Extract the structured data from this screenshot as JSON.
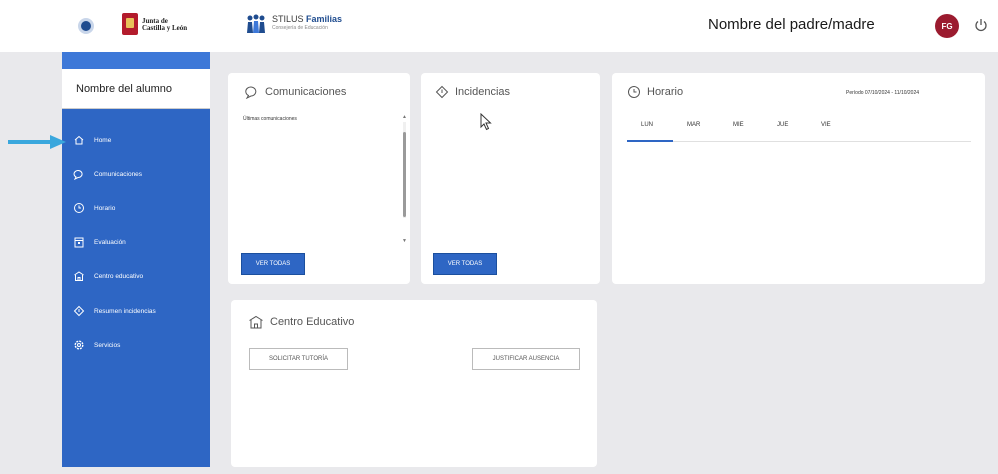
{
  "header": {
    "org_name_line1": "Junta de",
    "org_name_line2": "Castilla y León",
    "app_title_prefix": "STILUS ",
    "app_title_bold": "Familias",
    "app_subtitle": "Consejería de Educación",
    "parent_name": "Nombre del padre/madre",
    "avatar_initials": "FG"
  },
  "sidebar": {
    "student_name": "Nombre del alumno",
    "items": [
      {
        "label": "Home",
        "icon": "home-icon"
      },
      {
        "label": "Comunicaciones",
        "icon": "chat-icon"
      },
      {
        "label": "Horario",
        "icon": "clock-icon"
      },
      {
        "label": "Evaluación",
        "icon": "calendar-icon"
      },
      {
        "label": "Centro educativo",
        "icon": "school-icon"
      },
      {
        "label": "Resumen incidencias",
        "icon": "warning-diamond-icon"
      },
      {
        "label": "Servicios",
        "icon": "gear-icon"
      }
    ]
  },
  "comunicaciones": {
    "title": "Comunicaciones",
    "subtitle": "Últimas comunicaciones",
    "button": "VER TODAS"
  },
  "incidencias": {
    "title": "Incidencias",
    "button": "VER TODAS"
  },
  "horario": {
    "title": "Horario",
    "period": "Período 07/10/2024 - 11/10/2024",
    "days": [
      "LUN",
      "MAR",
      "MIE",
      "JUE",
      "VIE"
    ],
    "active_day": "LUN"
  },
  "centro": {
    "title": "Centro Educativo",
    "btn_tutoria": "SOLICITAR TUTORÍA",
    "btn_ausencia": "JUSTIFICAR AUSENCIA"
  },
  "colors": {
    "sidebar": "#2e66c4",
    "accent": "#1f4c8f",
    "avatar": "#9b1b2f",
    "arrow": "#3aa7dd"
  }
}
